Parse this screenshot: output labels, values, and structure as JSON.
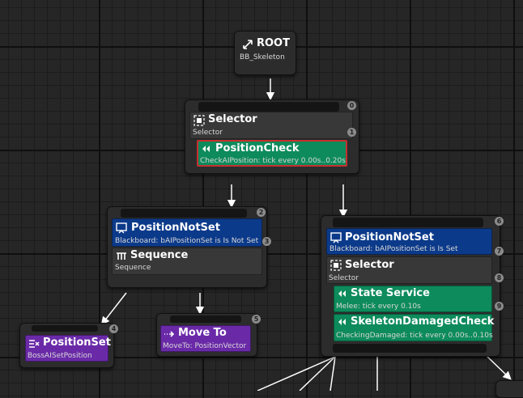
{
  "graph": {
    "root": {
      "title": "ROOT",
      "subtitle": "BB_Skeleton"
    },
    "selector_top": {
      "title": "Selector",
      "subtitle": "Selector",
      "index": "0",
      "index2": "1",
      "decorator": {
        "title": "PositionCheck",
        "subtitle": "CheckAIPosition: tick every 0.00s..0.20s"
      }
    },
    "left_group": {
      "index": "2",
      "index2": "3",
      "decorator": {
        "title": "PositionNotSet",
        "subtitle": "Blackboard: bAIPositionSet is Is Not Set"
      },
      "composite": {
        "title": "Sequence",
        "subtitle": "Sequence"
      }
    },
    "position_set": {
      "title": "PositionSet",
      "subtitle": "BossAISetPosition",
      "index": "4"
    },
    "move_to": {
      "title": "Move To",
      "subtitle": "MoveTo: PositionVector",
      "index": "5"
    },
    "right_group": {
      "index": "6",
      "index2": "7",
      "index3": "8",
      "index4": "9",
      "decorator": {
        "title": "PositionNotSet",
        "subtitle": "Blackboard: bAIPositionSet is Is Set"
      },
      "composite": {
        "title": "Selector",
        "subtitle": "Selector"
      },
      "service1": {
        "title": "State Service",
        "subtitle": "Melee: tick every 0.10s"
      },
      "service2": {
        "title": "SkeletonDamagedCheck",
        "subtitle": "CheckingDamaged: tick every 0.00s..0.10s"
      }
    }
  }
}
